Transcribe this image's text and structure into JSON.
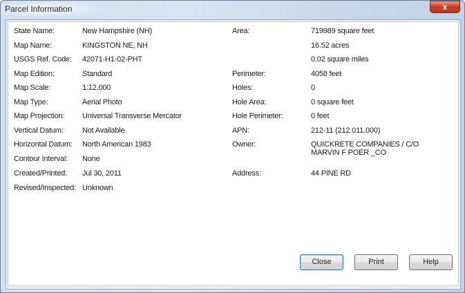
{
  "window": {
    "title": "Parcel Information",
    "close_glyph": "x"
  },
  "left_fields": [
    {
      "label": "State Name:",
      "value": "New Hampshire (NH)"
    },
    {
      "label": "Map Name:",
      "value": "KINGSTON NE, NH"
    },
    {
      "label": "USGS Ref. Code:",
      "value": "42071-H1-02-PHT"
    },
    {
      "label": "Map Edition:",
      "value": "Standard"
    },
    {
      "label": "Map Scale:",
      "value": "1:12,000"
    },
    {
      "label": "Map Type:",
      "value": "Aerial Photo"
    },
    {
      "label": "Map Projection:",
      "value": "Universal Transverse Mercator"
    },
    {
      "label": "Vertical Datum:",
      "value": "Not Available"
    },
    {
      "label": "Horizontal Datum:",
      "value": "North American 1983"
    },
    {
      "label": "Contour Interval:",
      "value": "None"
    },
    {
      "label": "Created/Printed:",
      "value": "Jul 30, 2011"
    },
    {
      "label": "Revised/Inspected:",
      "value": "Unknown"
    }
  ],
  "right_fields": {
    "area_label": "Area:",
    "area_sqft": "719989 square feet",
    "area_acres": "16.52 acres",
    "area_sqmi": "0.02 square miles",
    "perimeter_label": "Perimeter:",
    "perimeter_value": "4058 feet",
    "holes_label": "Holes:",
    "holes_value": "0",
    "hole_area_label": "Hole Area:",
    "hole_area_value": "0 square feet",
    "hole_perimeter_label": "Hole Perimeter:",
    "hole_perimeter_value": "0 feet",
    "apn_label": "APN:",
    "apn_value": "212-11 (212.011.000)",
    "owner_label": "Owner:",
    "owner_value": "QUICKRETE COMPANIES / C/O\nMARVIN F POER _CO",
    "address_label": "Address:",
    "address_value": "44 PINE RD"
  },
  "buttons": {
    "close": "Close",
    "print": "Print",
    "help": "Help"
  },
  "colors": {
    "titlebar_accent": "#cfe0ef",
    "close_button": "#c9432a",
    "default_button_border": "#3c7fb1"
  }
}
